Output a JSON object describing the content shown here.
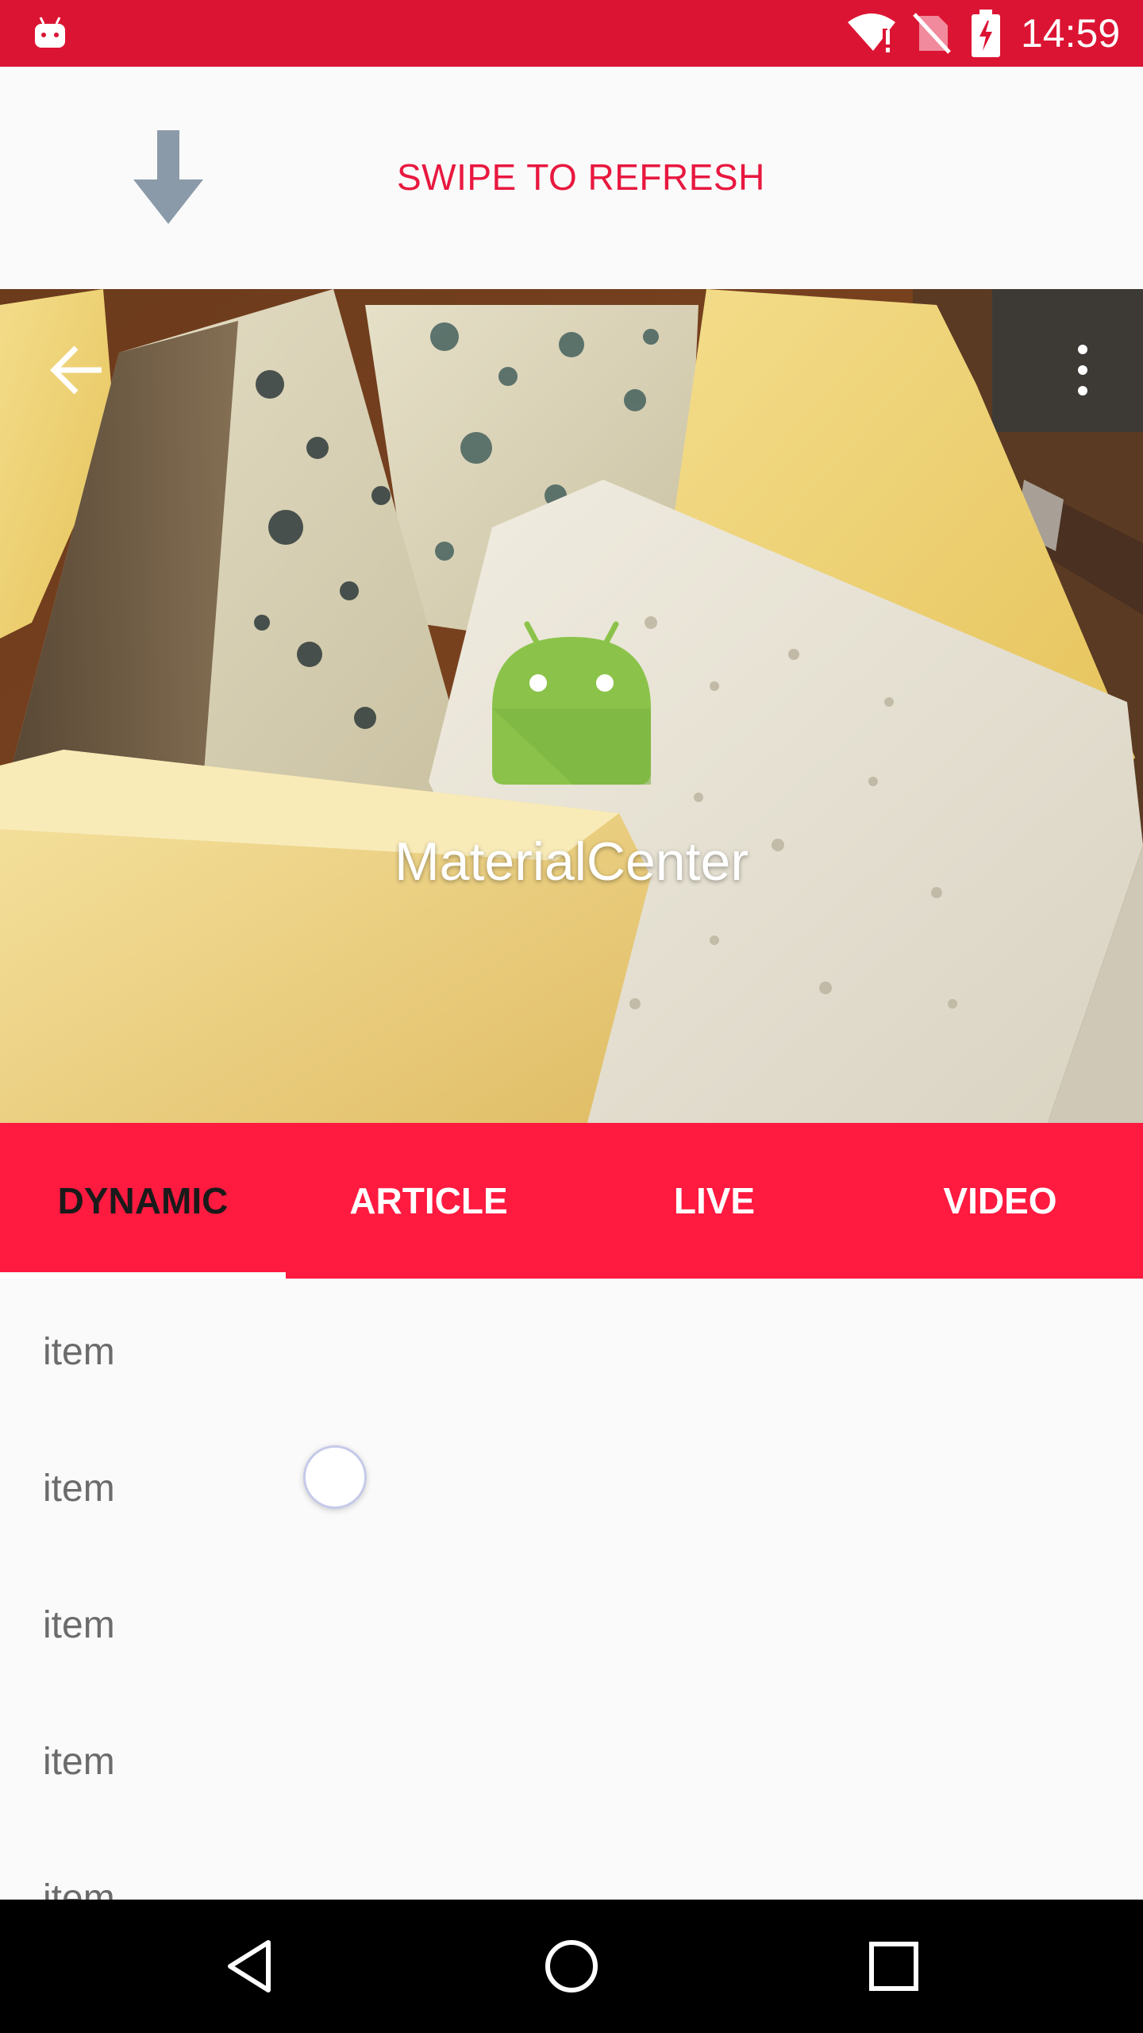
{
  "status_bar": {
    "time": "14:59",
    "color": "#dc1433",
    "icons": [
      "android-notification-icon",
      "wifi-icon",
      "no-sim-icon",
      "battery-charging-icon"
    ]
  },
  "refresh_header": {
    "label": "SWIPE TO REFRESH",
    "icon": "arrow-down-icon",
    "label_color": "#e8183f"
  },
  "toolbar": {
    "title": "MaterialCenter",
    "back_icon": "arrow-back-icon",
    "menu_icon": "more-vert-icon",
    "logo_icon": "android-logo-icon"
  },
  "tabs": {
    "items": [
      {
        "label": "DYNAMIC",
        "active": true
      },
      {
        "label": "ARTICLE",
        "active": false
      },
      {
        "label": "LIVE",
        "active": false
      },
      {
        "label": "VIDEO",
        "active": false
      }
    ],
    "background": "#ff1a40"
  },
  "list": {
    "items": [
      "item",
      "item",
      "item",
      "item",
      "item"
    ]
  },
  "nav_bar": {
    "icons": [
      "back-nav-icon",
      "home-nav-icon",
      "recents-nav-icon"
    ]
  }
}
